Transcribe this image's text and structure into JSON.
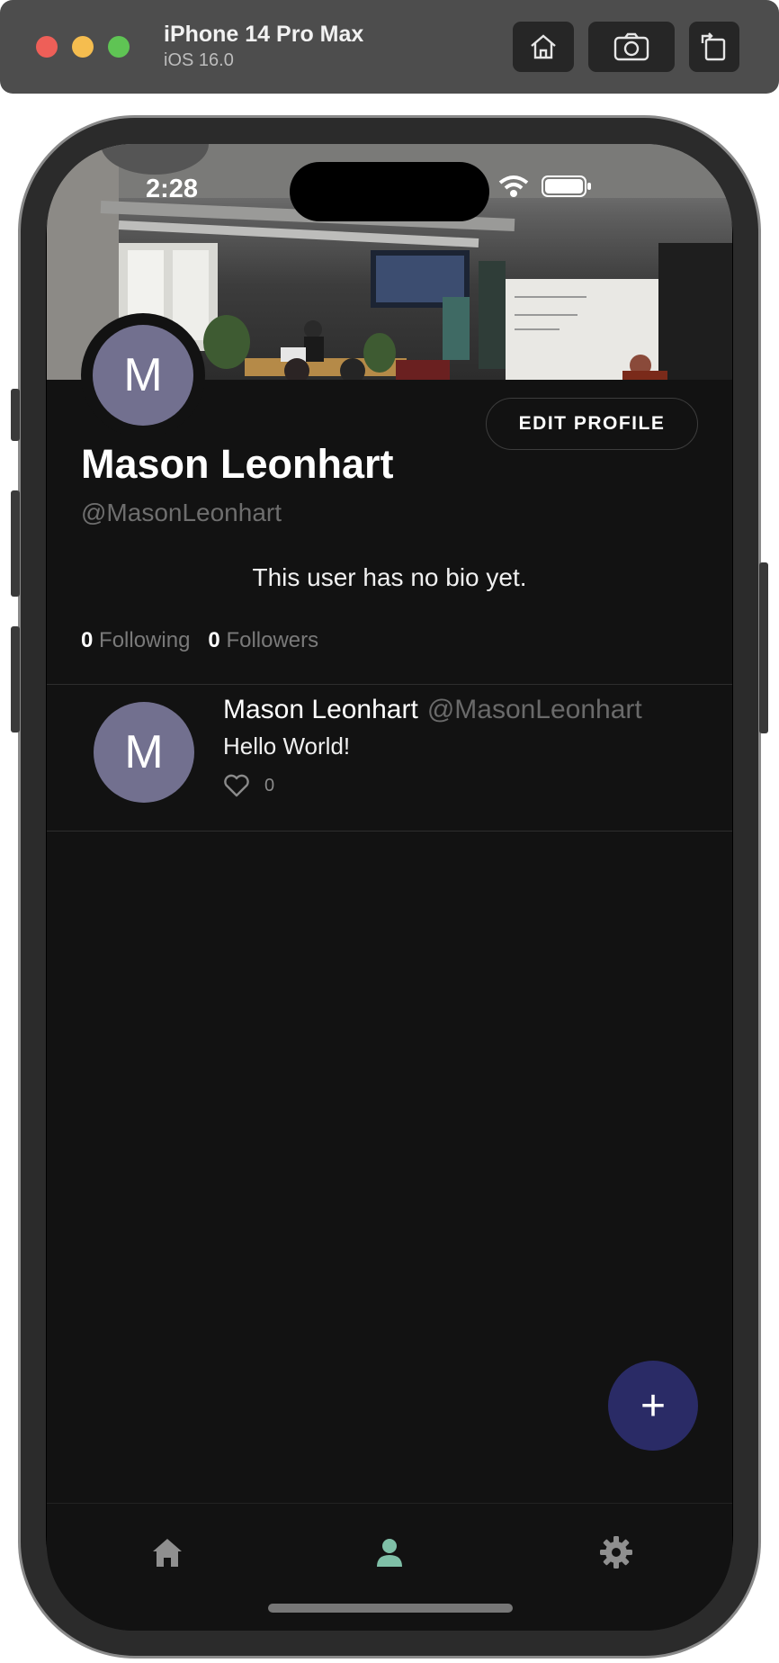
{
  "simulator": {
    "title": "iPhone 14 Pro Max",
    "subtitle": "iOS 16.0",
    "toolbar_icons": [
      "home-icon",
      "screenshot-icon",
      "rotate-icon"
    ]
  },
  "status_bar": {
    "time": "2:28",
    "icons": [
      "wifi-icon",
      "battery-icon"
    ]
  },
  "profile": {
    "avatar_letter": "M",
    "avatar_color": "#72708f",
    "edit_button_label": "EDIT PROFILE",
    "name": "Mason Leonhart",
    "handle": "@MasonLeonhart",
    "bio": "This user has no bio yet.",
    "following_count": "0",
    "following_label": "Following",
    "followers_count": "0",
    "followers_label": "Followers"
  },
  "posts": [
    {
      "avatar_letter": "M",
      "author_name": "Mason Leonhart",
      "author_handle": "@MasonLeonhart",
      "text": "Hello World!",
      "like_count": "0"
    }
  ],
  "fab": {
    "label": "+",
    "color": "#2a2b66"
  },
  "nav": {
    "items": [
      {
        "icon": "home-icon",
        "active": false
      },
      {
        "icon": "user-icon",
        "active": true
      },
      {
        "icon": "gear-icon",
        "active": false
      }
    ],
    "active_color": "#7fbfa7",
    "inactive_color": "#8f8f8f"
  },
  "colors": {
    "background": "#121212",
    "accent": "#2a2b66"
  }
}
